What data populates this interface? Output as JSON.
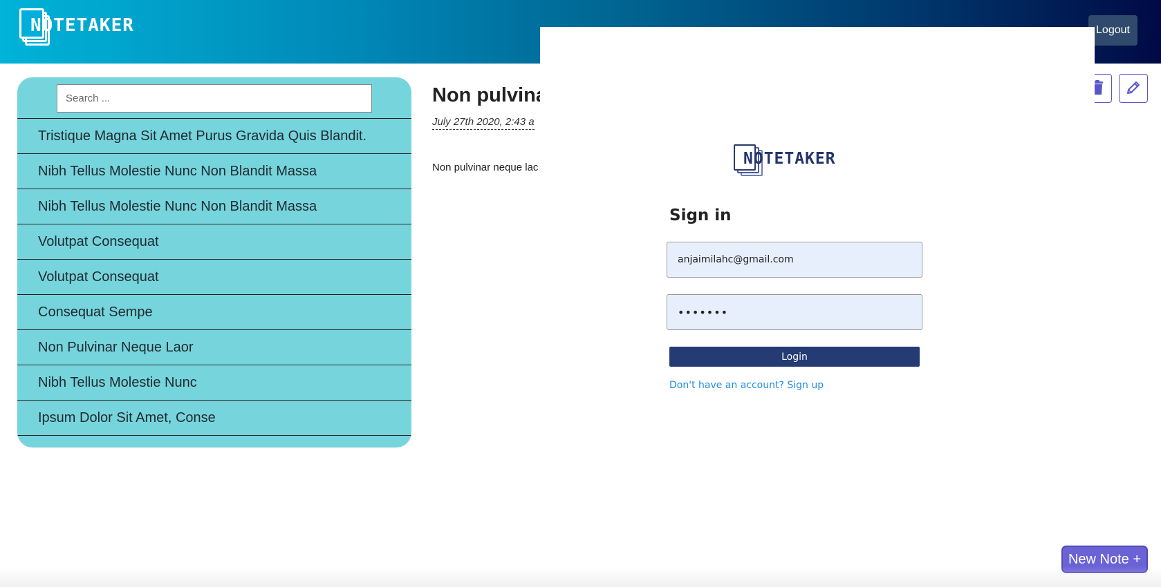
{
  "header": {
    "logo_text": "NOTETAKER",
    "logout_label": "Logout",
    "colors": {
      "gradient_start": "#00b3d8",
      "gradient_end": "#000a45"
    }
  },
  "sidebar": {
    "search_placeholder": "Search ...",
    "notes": [
      "Tristique Magna Sit Amet Purus Gravida Quis Blandit.",
      "Nibh Tellus Molestie Nunc Non Blandit Massa",
      "Nibh Tellus Molestie Nunc Non Blandit Massa",
      "Volutpat Consequat",
      "Volutpat Consequat",
      "Consequat Sempe",
      "Non Pulvinar Neque Laor",
      "Nibh Tellus Molestie Nunc",
      "Ipsum Dolor Sit Amet, Conse"
    ],
    "color": "#76d4dc"
  },
  "note": {
    "title": "Non pulvinar",
    "date": "July 27th 2020, 2:43 a",
    "body": "Non pulvinar neque lac"
  },
  "toolbar": {
    "trash_icon": "trash-icon",
    "edit_icon": "pencil-icon",
    "accent": "#5a55c9"
  },
  "signin_modal": {
    "logo_text": "NOTETAKER",
    "heading": "Sign in",
    "email_value": "anjaimilahc@gmail.com",
    "password_value": "•••••••",
    "login_label": "Login",
    "signup_link": "Don't have an account? Sign up",
    "button_color": "#243b73",
    "link_color": "#1f8ee0"
  },
  "new_note_label": "New Note +"
}
